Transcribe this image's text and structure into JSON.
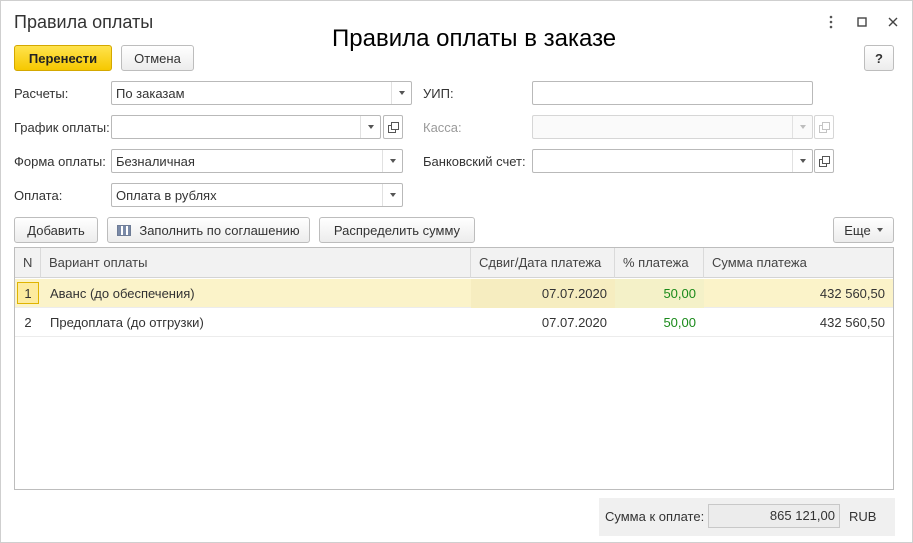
{
  "window": {
    "title": "Правила оплаты",
    "overlay_caption": "Правила оплаты в заказе",
    "menu_icon": "kebab-menu-icon",
    "maximize_icon": "maximize-icon",
    "close_icon": "close-icon"
  },
  "toolbar": {
    "transfer_label": "Перенести",
    "cancel_label": "Отмена",
    "help_label": "?"
  },
  "form": {
    "settlements_label": "Расчеты:",
    "settlements_value": "По заказам",
    "schedule_label": "График оплаты:",
    "schedule_value": "",
    "payment_form_label": "Форма оплаты:",
    "payment_form_value": "Безналичная",
    "payment_label": "Оплата:",
    "payment_value": "Оплата в рублях",
    "uip_label": "УИП:",
    "uip_value": "",
    "cashbox_label": "Касса:",
    "cashbox_value": "",
    "bank_account_label": "Банковский счет:",
    "bank_account_value": ""
  },
  "table_toolbar": {
    "add_label": "Добавить",
    "fill_label": "Заполнить по соглашению",
    "distribute_label": "Распределить сумму",
    "more_label": "Еще"
  },
  "table": {
    "columns": [
      "N",
      "Вариант оплаты",
      "Сдвиг/Дата платежа",
      "% платежа",
      "Сумма платежа"
    ],
    "rows": [
      {
        "n": "1",
        "variant": "Аванс (до обеспечения)",
        "date": "07.07.2020",
        "percent": "50,00",
        "amount": "432 560,50"
      },
      {
        "n": "2",
        "variant": "Предоплата (до отгрузки)",
        "date": "07.07.2020",
        "percent": "50,00",
        "amount": "432 560,50"
      }
    ]
  },
  "footer": {
    "total_label": "Сумма к оплате:",
    "total_value": "865 121,00",
    "currency": "RUB"
  },
  "colors": {
    "primary_button": "#f6c800",
    "selected_row": "#fbf3c9",
    "percent_text": "#1a8a1a"
  }
}
